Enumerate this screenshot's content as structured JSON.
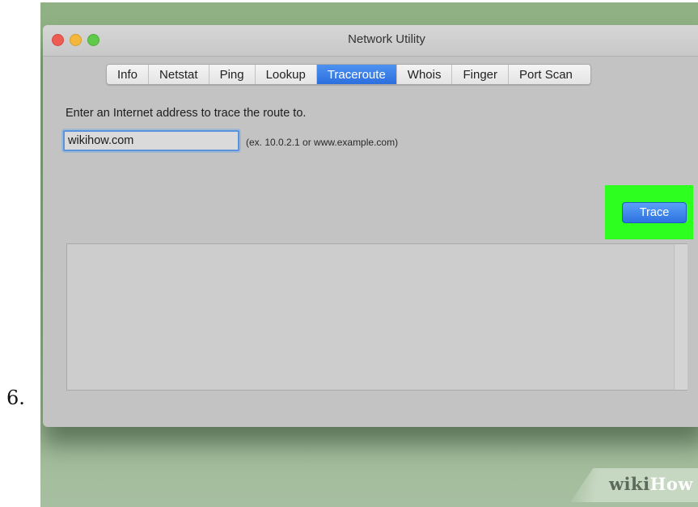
{
  "step": {
    "number": "6."
  },
  "window": {
    "title": "Network Utility",
    "tabs": [
      {
        "label": "Info",
        "active": false
      },
      {
        "label": "Netstat",
        "active": false
      },
      {
        "label": "Ping",
        "active": false
      },
      {
        "label": "Lookup",
        "active": false
      },
      {
        "label": "Traceroute",
        "active": true
      },
      {
        "label": "Whois",
        "active": false
      },
      {
        "label": "Finger",
        "active": false
      },
      {
        "label": "Port Scan",
        "active": false
      }
    ]
  },
  "traceroute": {
    "prompt": "Enter an Internet address to trace the route to.",
    "address_value": "wikihow.com",
    "hint": "(ex. 10.0.2.1 or www.example.com)",
    "trace_label": "Trace",
    "output": ""
  },
  "watermark": {
    "part1": "wiki",
    "part2": "How"
  },
  "colors": {
    "background_green": "#8fb184",
    "highlight_green": "#2dff1f",
    "accent_blue": "#2c6fde",
    "close": "#ee5b53",
    "minimize": "#f2b73b",
    "zoom": "#5fc94a"
  }
}
